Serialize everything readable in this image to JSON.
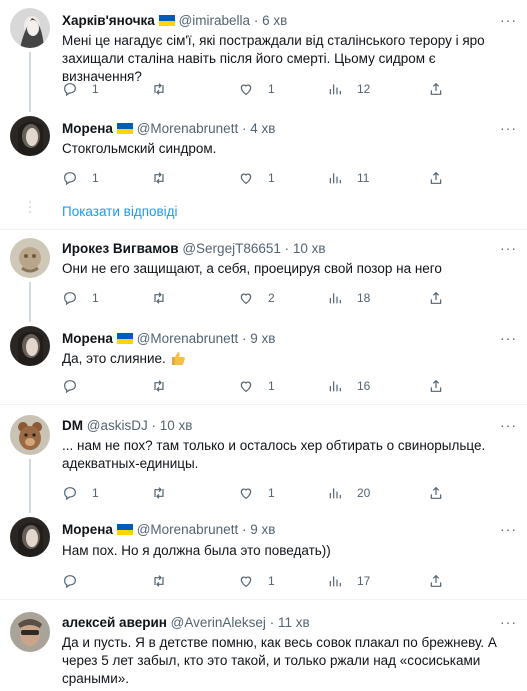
{
  "tweets": [
    {
      "name": "Харків'яночка",
      "flag": true,
      "handle": "@imirabella",
      "time": "6 хв",
      "text": "Мені це нагадує сім'ї, які постраждали від сталінського терору і яро захищали сталіна навіть після його смерті. Цьому сидром є визначення?",
      "replies": "1",
      "retweets": "",
      "likes": "1",
      "views": "12"
    },
    {
      "name": "Морена",
      "flag": true,
      "handle": "@Morenabrunett",
      "time": "4 хв",
      "text": "Стокгольмский синдром.",
      "replies": "1",
      "retweets": "",
      "likes": "1",
      "views": "11"
    },
    {
      "name": "Ирокез Вигвамов",
      "flag": false,
      "handle": "@SergejT86651",
      "time": "10 хв",
      "text": "Они не его защищают, а себя, проецируя свой позор на него",
      "replies": "1",
      "retweets": "",
      "likes": "2",
      "views": "18"
    },
    {
      "name": "Морена",
      "flag": true,
      "handle": "@Morenabrunett",
      "time": "9 хв",
      "text": "Да, это слияние.",
      "replies": "",
      "retweets": "",
      "likes": "1",
      "views": "16"
    },
    {
      "name": "DM",
      "flag": false,
      "handle": "@askisDJ",
      "time": "10 хв",
      "text": "... нам не пох? там только и осталось хер обтирать о свинорыльце. адекватных-единицы.",
      "replies": "1",
      "retweets": "",
      "likes": "1",
      "views": "20"
    },
    {
      "name": "Морена",
      "flag": true,
      "handle": "@Morenabrunett",
      "time": "9 хв",
      "text": "Нам пох. Но я должна была это поведать))",
      "replies": "",
      "retweets": "",
      "likes": "1",
      "views": "17"
    },
    {
      "name": "алексей аверин",
      "flag": false,
      "handle": "@AverinAleksej",
      "time": "11 хв",
      "text": "Да и пусть. Я в детстве помню, как весь совок плакал по брежневу. А через 5 лет забыл, кто это такой, и только ржали над «сосиськами сраными».",
      "replies": "",
      "retweets": "",
      "likes": "",
      "views": ""
    }
  ],
  "show_replies_label": "Показати відповіді",
  "separator_dot": "·",
  "colors": {
    "accent": "#1d9bf0",
    "muted": "#536471",
    "flag_blue": "#005bbb",
    "flag_yellow": "#ffd500"
  },
  "icons": [
    "reply-icon",
    "retweet-icon",
    "like-icon",
    "views-icon",
    "share-icon",
    "more-icon"
  ]
}
